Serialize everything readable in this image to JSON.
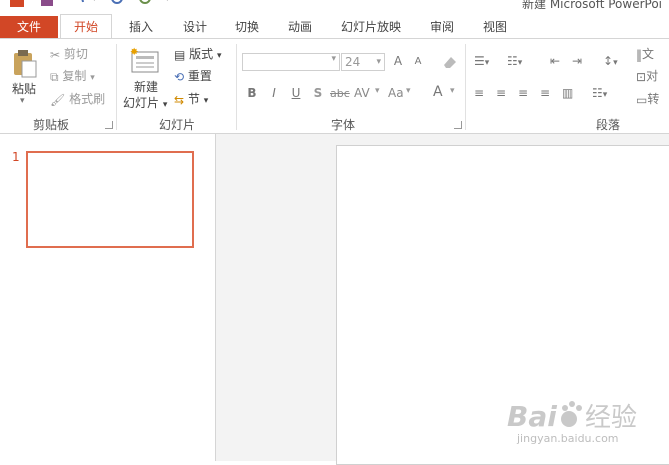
{
  "window": {
    "title": "新建 Microsoft PowerPoi"
  },
  "tabs": {
    "file": "文件",
    "home": "开始",
    "insert": "插入",
    "design": "设计",
    "transitions": "切换",
    "animations": "动画",
    "slideshow": "幻灯片放映",
    "review": "审阅",
    "view": "视图"
  },
  "clipboard": {
    "paste": "粘贴",
    "cut": "剪切",
    "copy": "复制",
    "format_painter": "格式刷",
    "label": "剪贴板"
  },
  "slides": {
    "new_slide_line1": "新建",
    "new_slide_line2": "幻灯片",
    "layout": "版式",
    "reset": "重置",
    "section": "节",
    "label": "幻灯片"
  },
  "font": {
    "name": "",
    "size": "24",
    "grow": "A",
    "shrink": "A",
    "bold": "B",
    "italic": "I",
    "underline": "U",
    "shadow": "S",
    "strike": "abc",
    "spacing": "AV",
    "case": "Aa",
    "color": "A",
    "label": "字体"
  },
  "paragraph": {
    "text_direction": "文",
    "align_text": "对",
    "convert": "转",
    "label": "段落"
  },
  "thumbnails": [
    {
      "number": "1"
    }
  ],
  "watermark": {
    "brand": "Bai",
    "brand2": "经验",
    "url": "jingyan.baidu.com"
  },
  "colors": {
    "accent": "#d24726",
    "thumb_border": "#e06d4f"
  }
}
